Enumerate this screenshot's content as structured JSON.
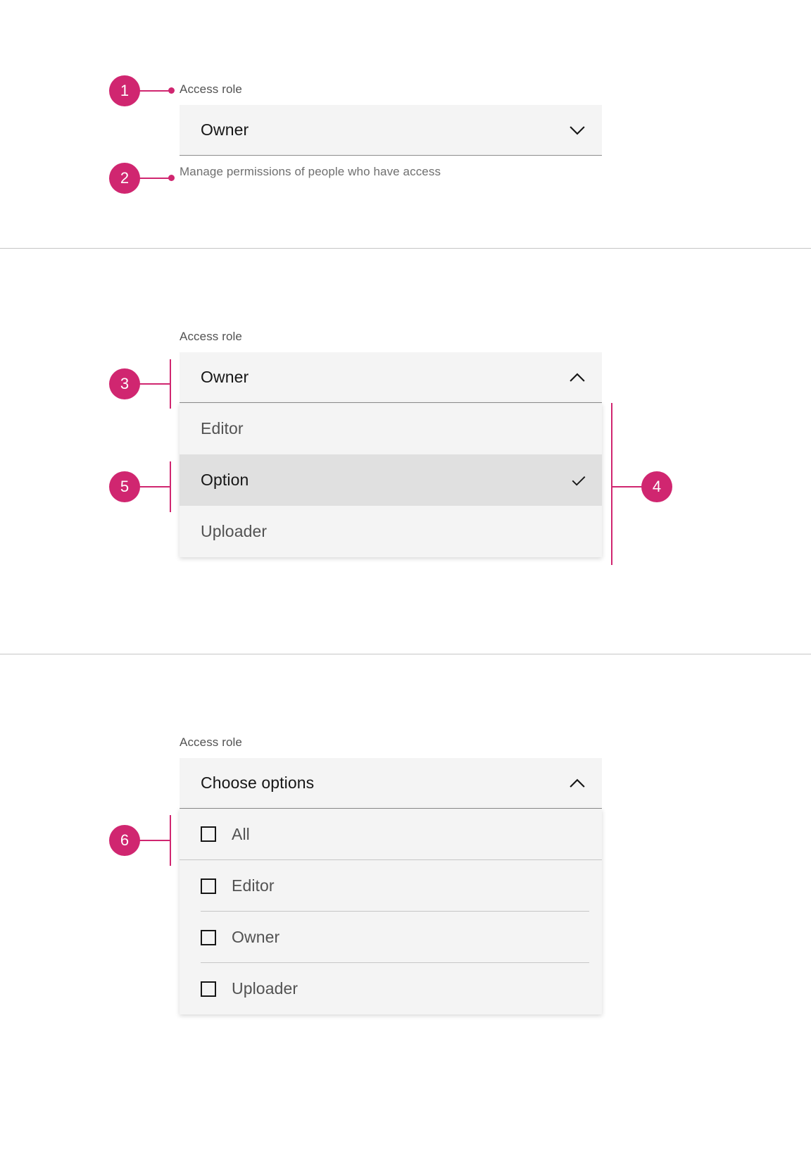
{
  "accent_color": "#d02670",
  "field_background": "#f4f4f4",
  "selected_row_background": "#e0e0e0",
  "sections": {
    "closed": {
      "label": "Access role",
      "value": "Owner",
      "helper_text": "Manage permissions of people who have access",
      "chevron_icon": "chevron-down-icon",
      "state": "closed"
    },
    "open_single": {
      "label": "Access role",
      "value": "Owner",
      "chevron_icon": "chevron-up-icon",
      "state": "open",
      "options": [
        {
          "label": "Editor",
          "selected": false
        },
        {
          "label": "Option",
          "selected": true
        },
        {
          "label": "Uploader",
          "selected": false
        }
      ],
      "check_icon": "checkmark-icon"
    },
    "open_multi": {
      "label": "Access role",
      "value": "Choose options",
      "chevron_icon": "chevron-up-icon",
      "state": "open",
      "options": [
        {
          "label": "All",
          "checked": false
        },
        {
          "label": "Editor",
          "checked": false
        },
        {
          "label": "Owner",
          "checked": false
        },
        {
          "label": "Uploader",
          "checked": false
        }
      ],
      "checkbox_icon": "checkbox-unchecked-icon"
    }
  },
  "annotations": [
    {
      "number": "1",
      "target": "field-label"
    },
    {
      "number": "2",
      "target": "helper-text"
    },
    {
      "number": "3",
      "target": "field-trigger"
    },
    {
      "number": "4",
      "target": "option-list"
    },
    {
      "number": "5",
      "target": "selected-option"
    },
    {
      "number": "6",
      "target": "select-all-option"
    }
  ]
}
